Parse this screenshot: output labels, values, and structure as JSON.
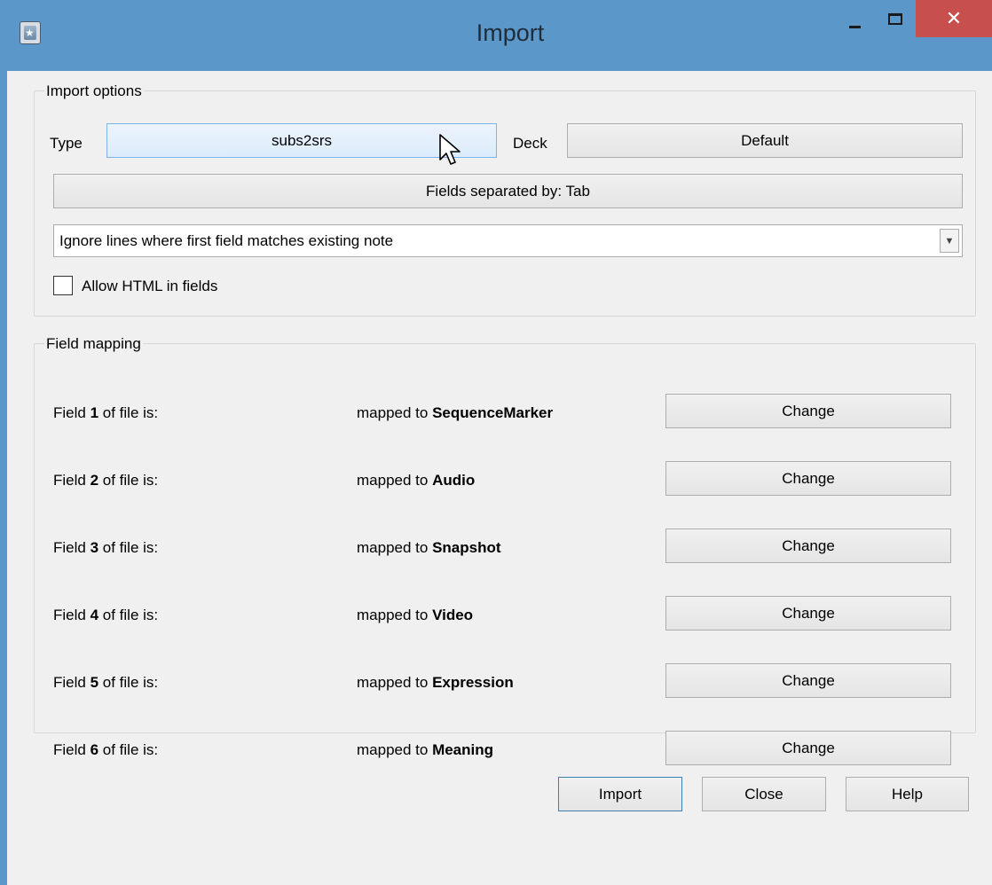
{
  "window": {
    "title": "Import",
    "close_glyph": "✕",
    "accent_color": "#5c97c9",
    "close_color": "#c7504f"
  },
  "import_options": {
    "group_title": "Import options",
    "type_label": "Type",
    "type_value": "subs2srs",
    "deck_label": "Deck",
    "deck_value": "Default",
    "separator_button": "Fields separated by: Tab",
    "duplicate_handling": "Ignore lines where first field matches existing note",
    "allow_html_label": "Allow HTML in fields",
    "allow_html_checked": false
  },
  "field_mapping": {
    "group_title": "Field mapping",
    "rows": [
      {
        "prefix": "Field ",
        "number": "1",
        "suffix": " of file is:",
        "mapped_prefix": "mapped to ",
        "target": "SequenceMarker",
        "button": "Change"
      },
      {
        "prefix": "Field ",
        "number": "2",
        "suffix": " of file is:",
        "mapped_prefix": "mapped to ",
        "target": "Audio",
        "button": "Change"
      },
      {
        "prefix": "Field ",
        "number": "3",
        "suffix": " of file is:",
        "mapped_prefix": "mapped to ",
        "target": "Snapshot",
        "button": "Change"
      },
      {
        "prefix": "Field ",
        "number": "4",
        "suffix": " of file is:",
        "mapped_prefix": "mapped to ",
        "target": "Video",
        "button": "Change"
      },
      {
        "prefix": "Field ",
        "number": "5",
        "suffix": " of file is:",
        "mapped_prefix": "mapped to ",
        "target": "Expression",
        "button": "Change"
      },
      {
        "prefix": "Field ",
        "number": "6",
        "suffix": " of file is:",
        "mapped_prefix": "mapped to ",
        "target": "Meaning",
        "button": "Change"
      }
    ]
  },
  "buttons": {
    "import": "Import",
    "close": "Close",
    "help": "Help"
  },
  "icons": {
    "app": "anki-app-icon",
    "minimize": "minimize-icon",
    "maximize": "maximize-icon",
    "close": "close-icon",
    "dropdown": "chevron-down-icon",
    "cursor": "mouse-pointer-icon"
  }
}
